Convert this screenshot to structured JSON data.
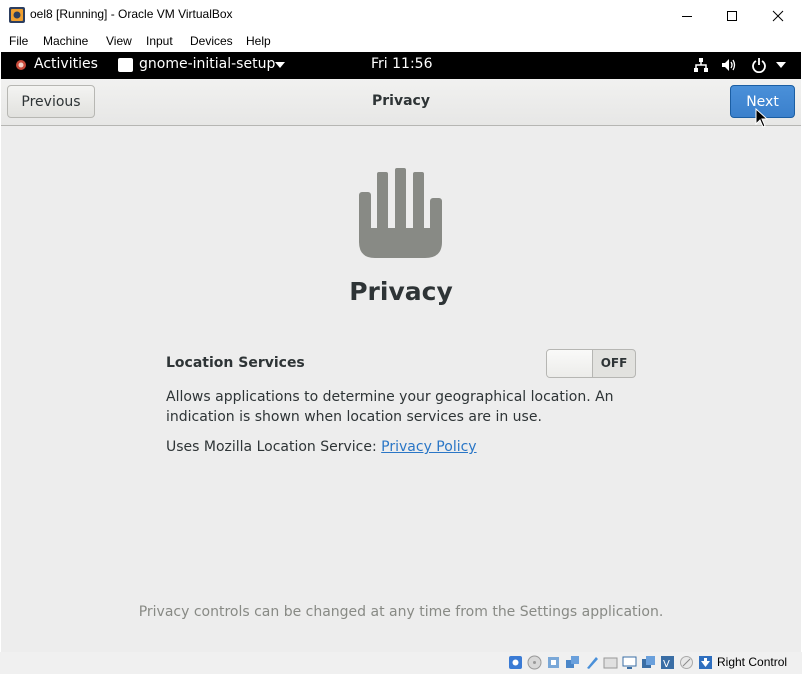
{
  "window": {
    "title": "oel8 [Running] - Oracle VM VirtualBox",
    "controls": [
      "minimize-icon",
      "maximize-icon",
      "close-icon"
    ]
  },
  "menu": [
    "File",
    "Machine",
    "View",
    "Input",
    "Devices",
    "Help"
  ],
  "gnome_top_bar": {
    "activities": "Activities",
    "app_menu": "gnome-initial-setup",
    "clock": "Fri 11:56",
    "status_icons": [
      "network-icon",
      "volume-icon",
      "power-icon",
      "chevron-down-icon"
    ]
  },
  "header": {
    "previous": "Previous",
    "title": "Privacy",
    "next": "Next"
  },
  "page": {
    "icon": "hand-stop-icon",
    "title": "Privacy",
    "location_services_label": "Location Services",
    "toggle_state": "OFF",
    "description_line1": "Allows applications to determine your geographical location. An",
    "description_line2": "indication is shown when location services are in use.",
    "mozilla_text": "Uses Mozilla Location Service: ",
    "privacy_policy_link": "Privacy Policy",
    "footer": "Privacy controls can be changed at any time from the Settings application."
  },
  "statusbar": {
    "icons": [
      "hard-disk-icon",
      "optical-drive-icon",
      "audio-icon",
      "network-adapter-icon",
      "usb-icon",
      "shared-folders-icon",
      "display-icon",
      "capture-icon",
      "recording-icon",
      "virtualization-icon",
      "mouse-integration-icon",
      "keyboard-capture-icon"
    ],
    "host_key": "Right Control"
  },
  "colors": {
    "accent": "#3b80cc",
    "link": "#2a76c6",
    "gnome_bar": "#000000",
    "vm_background": "#ededed"
  }
}
